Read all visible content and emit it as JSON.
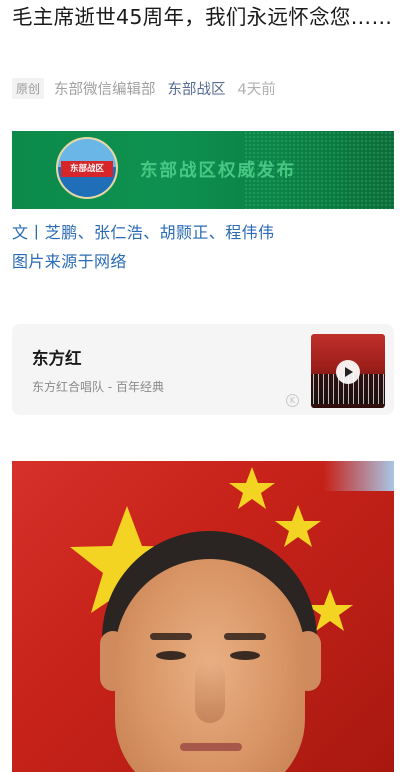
{
  "article": {
    "title": "毛主席逝世45周年，我们永远怀念您……",
    "original_tag": "原创",
    "author": "东部微信编辑部",
    "account": "东部战区",
    "time": "4天前"
  },
  "banner": {
    "logo_text": "东部战区",
    "text": "东部战区权威发布"
  },
  "credits": {
    "line1": "文丨芝鹏、张仁浩、胡颢正、程伟伟",
    "line2": "图片来源于网络"
  },
  "music": {
    "title": "东方红",
    "subtitle": "东方红合唱队 - 百年经典",
    "k_mark": "K"
  },
  "colors": {
    "link_blue": "#576b95",
    "credit_blue": "#2a6bb5",
    "banner_green": "#0e9150"
  }
}
